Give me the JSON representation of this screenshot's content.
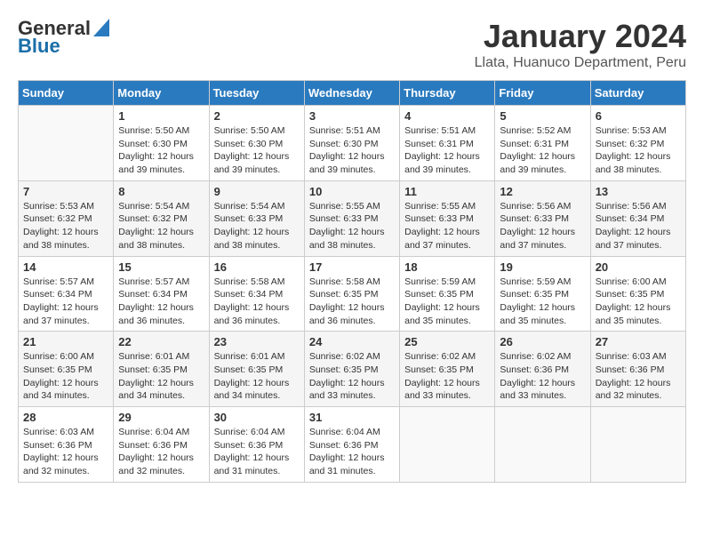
{
  "logo": {
    "general": "General",
    "blue": "Blue"
  },
  "title": "January 2024",
  "location": "Llata, Huanuco Department, Peru",
  "days_header": [
    "Sunday",
    "Monday",
    "Tuesday",
    "Wednesday",
    "Thursday",
    "Friday",
    "Saturday"
  ],
  "weeks": [
    [
      {
        "day": "",
        "info": ""
      },
      {
        "day": "1",
        "info": "Sunrise: 5:50 AM\nSunset: 6:30 PM\nDaylight: 12 hours\nand 39 minutes."
      },
      {
        "day": "2",
        "info": "Sunrise: 5:50 AM\nSunset: 6:30 PM\nDaylight: 12 hours\nand 39 minutes."
      },
      {
        "day": "3",
        "info": "Sunrise: 5:51 AM\nSunset: 6:30 PM\nDaylight: 12 hours\nand 39 minutes."
      },
      {
        "day": "4",
        "info": "Sunrise: 5:51 AM\nSunset: 6:31 PM\nDaylight: 12 hours\nand 39 minutes."
      },
      {
        "day": "5",
        "info": "Sunrise: 5:52 AM\nSunset: 6:31 PM\nDaylight: 12 hours\nand 39 minutes."
      },
      {
        "day": "6",
        "info": "Sunrise: 5:53 AM\nSunset: 6:32 PM\nDaylight: 12 hours\nand 38 minutes."
      }
    ],
    [
      {
        "day": "7",
        "info": "Sunrise: 5:53 AM\nSunset: 6:32 PM\nDaylight: 12 hours\nand 38 minutes."
      },
      {
        "day": "8",
        "info": "Sunrise: 5:54 AM\nSunset: 6:32 PM\nDaylight: 12 hours\nand 38 minutes."
      },
      {
        "day": "9",
        "info": "Sunrise: 5:54 AM\nSunset: 6:33 PM\nDaylight: 12 hours\nand 38 minutes."
      },
      {
        "day": "10",
        "info": "Sunrise: 5:55 AM\nSunset: 6:33 PM\nDaylight: 12 hours\nand 38 minutes."
      },
      {
        "day": "11",
        "info": "Sunrise: 5:55 AM\nSunset: 6:33 PM\nDaylight: 12 hours\nand 37 minutes."
      },
      {
        "day": "12",
        "info": "Sunrise: 5:56 AM\nSunset: 6:33 PM\nDaylight: 12 hours\nand 37 minutes."
      },
      {
        "day": "13",
        "info": "Sunrise: 5:56 AM\nSunset: 6:34 PM\nDaylight: 12 hours\nand 37 minutes."
      }
    ],
    [
      {
        "day": "14",
        "info": "Sunrise: 5:57 AM\nSunset: 6:34 PM\nDaylight: 12 hours\nand 37 minutes."
      },
      {
        "day": "15",
        "info": "Sunrise: 5:57 AM\nSunset: 6:34 PM\nDaylight: 12 hours\nand 36 minutes."
      },
      {
        "day": "16",
        "info": "Sunrise: 5:58 AM\nSunset: 6:34 PM\nDaylight: 12 hours\nand 36 minutes."
      },
      {
        "day": "17",
        "info": "Sunrise: 5:58 AM\nSunset: 6:35 PM\nDaylight: 12 hours\nand 36 minutes."
      },
      {
        "day": "18",
        "info": "Sunrise: 5:59 AM\nSunset: 6:35 PM\nDaylight: 12 hours\nand 35 minutes."
      },
      {
        "day": "19",
        "info": "Sunrise: 5:59 AM\nSunset: 6:35 PM\nDaylight: 12 hours\nand 35 minutes."
      },
      {
        "day": "20",
        "info": "Sunrise: 6:00 AM\nSunset: 6:35 PM\nDaylight: 12 hours\nand 35 minutes."
      }
    ],
    [
      {
        "day": "21",
        "info": "Sunrise: 6:00 AM\nSunset: 6:35 PM\nDaylight: 12 hours\nand 34 minutes."
      },
      {
        "day": "22",
        "info": "Sunrise: 6:01 AM\nSunset: 6:35 PM\nDaylight: 12 hours\nand 34 minutes."
      },
      {
        "day": "23",
        "info": "Sunrise: 6:01 AM\nSunset: 6:35 PM\nDaylight: 12 hours\nand 34 minutes."
      },
      {
        "day": "24",
        "info": "Sunrise: 6:02 AM\nSunset: 6:35 PM\nDaylight: 12 hours\nand 33 minutes."
      },
      {
        "day": "25",
        "info": "Sunrise: 6:02 AM\nSunset: 6:35 PM\nDaylight: 12 hours\nand 33 minutes."
      },
      {
        "day": "26",
        "info": "Sunrise: 6:02 AM\nSunset: 6:36 PM\nDaylight: 12 hours\nand 33 minutes."
      },
      {
        "day": "27",
        "info": "Sunrise: 6:03 AM\nSunset: 6:36 PM\nDaylight: 12 hours\nand 32 minutes."
      }
    ],
    [
      {
        "day": "28",
        "info": "Sunrise: 6:03 AM\nSunset: 6:36 PM\nDaylight: 12 hours\nand 32 minutes."
      },
      {
        "day": "29",
        "info": "Sunrise: 6:04 AM\nSunset: 6:36 PM\nDaylight: 12 hours\nand 32 minutes."
      },
      {
        "day": "30",
        "info": "Sunrise: 6:04 AM\nSunset: 6:36 PM\nDaylight: 12 hours\nand 31 minutes."
      },
      {
        "day": "31",
        "info": "Sunrise: 6:04 AM\nSunset: 6:36 PM\nDaylight: 12 hours\nand 31 minutes."
      },
      {
        "day": "",
        "info": ""
      },
      {
        "day": "",
        "info": ""
      },
      {
        "day": "",
        "info": ""
      }
    ]
  ]
}
